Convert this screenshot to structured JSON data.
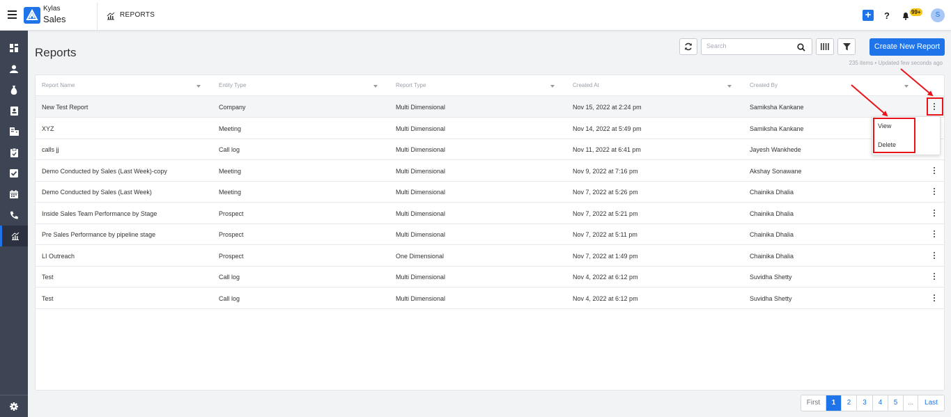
{
  "app": {
    "brand_top": "Kylas",
    "brand_bottom": "Sales",
    "section": "REPORTS",
    "notification_badge": "99+",
    "avatar_initial": "S"
  },
  "page": {
    "title": "Reports",
    "create_label": "Create New Report",
    "meta": "235 items • Updated few seconds ago"
  },
  "search": {
    "placeholder": "Search",
    "value": ""
  },
  "table": {
    "headers": [
      "Report Name",
      "Entity Type",
      "Report Type",
      "Created At",
      "Created By"
    ],
    "rows": [
      [
        "New Test Report",
        "Company",
        "Multi Dimensional",
        "Nov 15, 2022 at 2:24 pm",
        "Samiksha Kankane"
      ],
      [
        "XYZ",
        "Meeting",
        "Multi Dimensional",
        "Nov 14, 2022 at 5:49 pm",
        "Samiksha Kankane"
      ],
      [
        "calls jj",
        "Call log",
        "Multi Dimensional",
        "Nov 11, 2022 at 6:41 pm",
        "Jayesh Wankhede"
      ],
      [
        "Demo Conducted by Sales (Last Week)-copy",
        "Meeting",
        "Multi Dimensional",
        "Nov 9, 2022 at 7:16 pm",
        "Akshay Sonawane"
      ],
      [
        "Demo Conducted by Sales (Last Week)",
        "Meeting",
        "Multi Dimensional",
        "Nov 7, 2022 at 5:26 pm",
        "Chainika Dhalia"
      ],
      [
        "Inside Sales Team Performance by Stage",
        "Prospect",
        "Multi Dimensional",
        "Nov 7, 2022 at 5:21 pm",
        "Chainika Dhalia"
      ],
      [
        "Pre Sales Performance by pipeline stage",
        "Prospect",
        "Multi Dimensional",
        "Nov 7, 2022 at 5:11 pm",
        "Chainika Dhalia"
      ],
      [
        "LI Outreach",
        "Prospect",
        "One Dimensional",
        "Nov 7, 2022 at 1:49 pm",
        "Chainika Dhalia"
      ],
      [
        "Test",
        "Call log",
        "Multi Dimensional",
        "Nov 4, 2022 at 6:12 pm",
        "Suvidha Shetty"
      ],
      [
        "Test",
        "Call log",
        "Multi Dimensional",
        "Nov 4, 2022 at 6:12 pm",
        "Suvidha Shetty"
      ]
    ]
  },
  "row_menu": {
    "view": "View",
    "delete": "Delete"
  },
  "pagination": {
    "first": "First",
    "pages": [
      "1",
      "2",
      "3",
      "4",
      "5"
    ],
    "ellipsis": "...",
    "last": "Last",
    "current": "1"
  },
  "sidebar": {
    "icons": [
      "dashboard-icon",
      "user-icon",
      "money-bag-icon",
      "contact-card-icon",
      "building-icon",
      "clipboard-icon",
      "task-check-icon",
      "calendar-icon",
      "phone-icon",
      "reports-chart-icon"
    ],
    "active": "reports-chart-icon"
  },
  "colors": {
    "primary": "#1e74e8",
    "sidebar": "#3d4454",
    "annotation": "#e8141a",
    "badge": "#f5c518"
  }
}
